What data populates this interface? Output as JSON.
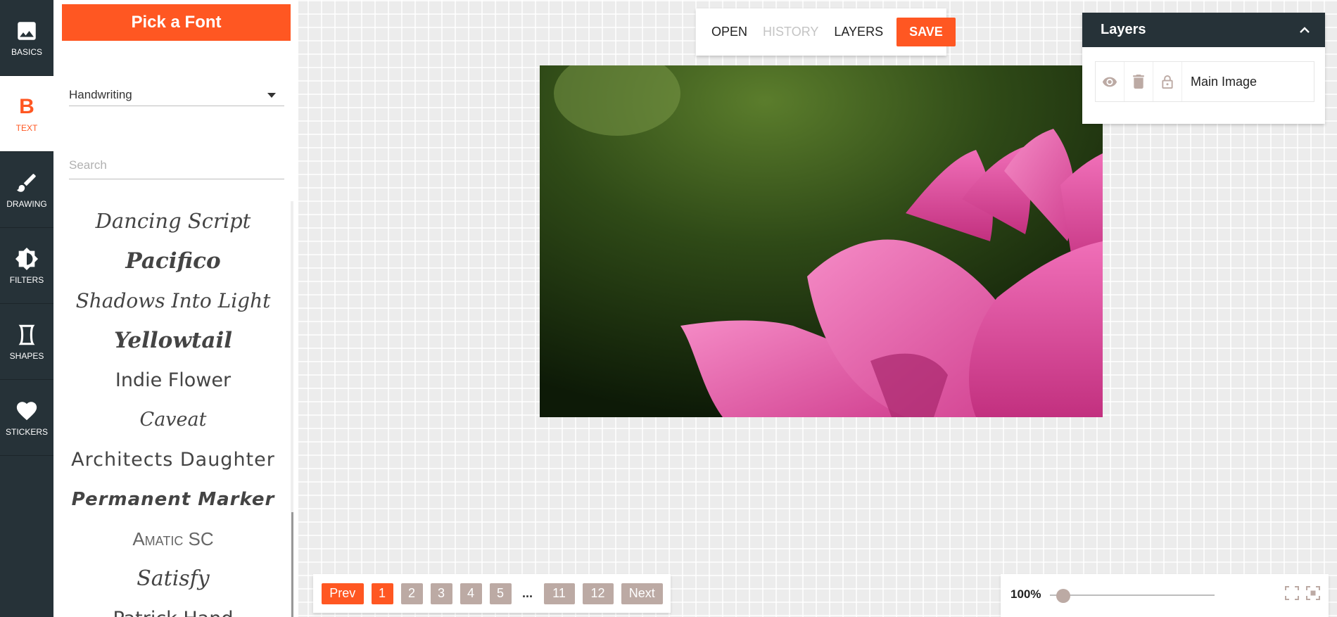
{
  "nav": {
    "items": [
      {
        "label": "BASICS",
        "icon": "image-icon"
      },
      {
        "label": "TEXT",
        "icon": "bold-b-icon",
        "glyph": "B"
      },
      {
        "label": "DRAWING",
        "icon": "brush-icon"
      },
      {
        "label": "FILTERS",
        "icon": "brightness-icon"
      },
      {
        "label": "SHAPES",
        "icon": "shape-icon"
      },
      {
        "label": "STICKERS",
        "icon": "heart-icon"
      }
    ]
  },
  "panel": {
    "pick_font_label": "Pick a Font",
    "category_value": "Handwriting",
    "search_placeholder": "Search",
    "fonts": [
      "Dancing Script",
      "Pacifico",
      "Shadows Into Light",
      "Yellowtail",
      "Indie Flower",
      "Caveat",
      "Architects Daughter",
      "Permanent Marker",
      "Amatic SC",
      "Satisfy",
      "Patrick Hand"
    ]
  },
  "toolbar": {
    "open": "OPEN",
    "history": "HISTORY",
    "layers": "LAYERS",
    "save": "SAVE"
  },
  "layers_panel": {
    "title": "Layers",
    "layer_name": "Main Image"
  },
  "pagination": {
    "prev": "Prev",
    "pages": [
      "1",
      "2",
      "3",
      "4",
      "5"
    ],
    "ellipsis": "...",
    "last_pages": [
      "11",
      "12"
    ],
    "next": "Next",
    "current": "1"
  },
  "zoom": {
    "value_label": "100%",
    "level": 1.0
  },
  "colors": {
    "accent": "#ff5722",
    "nav_bg": "#263238",
    "page_button": "#bcaaa4"
  }
}
